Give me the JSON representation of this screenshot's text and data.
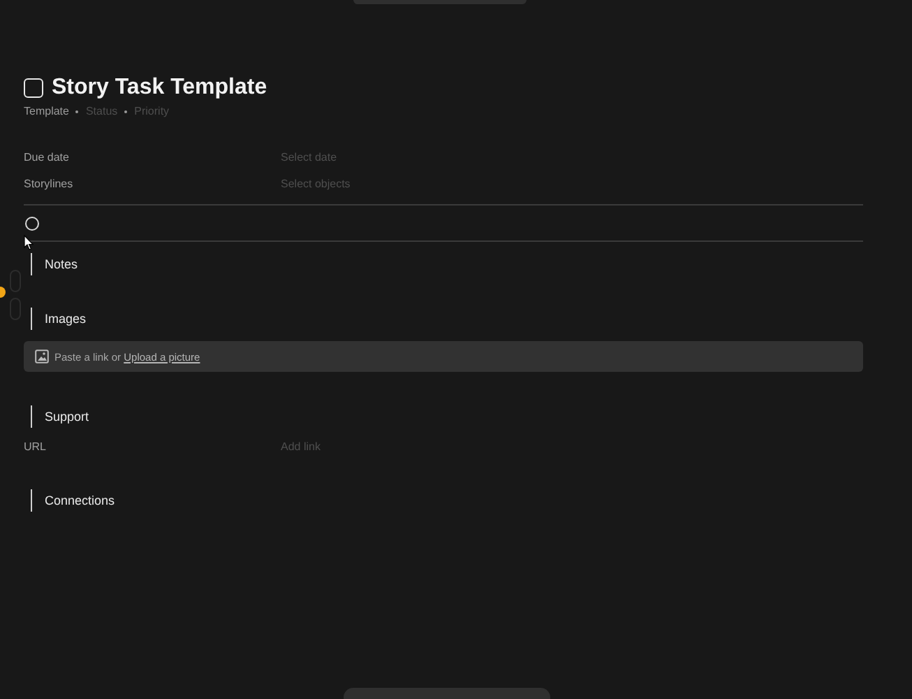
{
  "title": {
    "text": "Story Task Template",
    "checked": false
  },
  "meta": [
    {
      "text": "Template",
      "filled": true
    },
    {
      "text": "Status",
      "filled": false
    },
    {
      "text": "Priority",
      "filled": false
    }
  ],
  "fields": [
    {
      "label": "Due date",
      "placeholder": "Select date"
    },
    {
      "label": "Storylines",
      "placeholder": "Select objects"
    }
  ],
  "task_checkbox": {
    "checked": false
  },
  "sections": [
    {
      "heading": "Notes",
      "kind": "empty"
    },
    {
      "heading": "Images",
      "kind": "image",
      "image_prompt": "Paste a link or ",
      "image_link": "Upload a picture"
    },
    {
      "heading": "Support",
      "kind": "field",
      "label": "URL",
      "placeholder": "Add link"
    },
    {
      "heading": "Connections",
      "kind": "empty"
    }
  ]
}
